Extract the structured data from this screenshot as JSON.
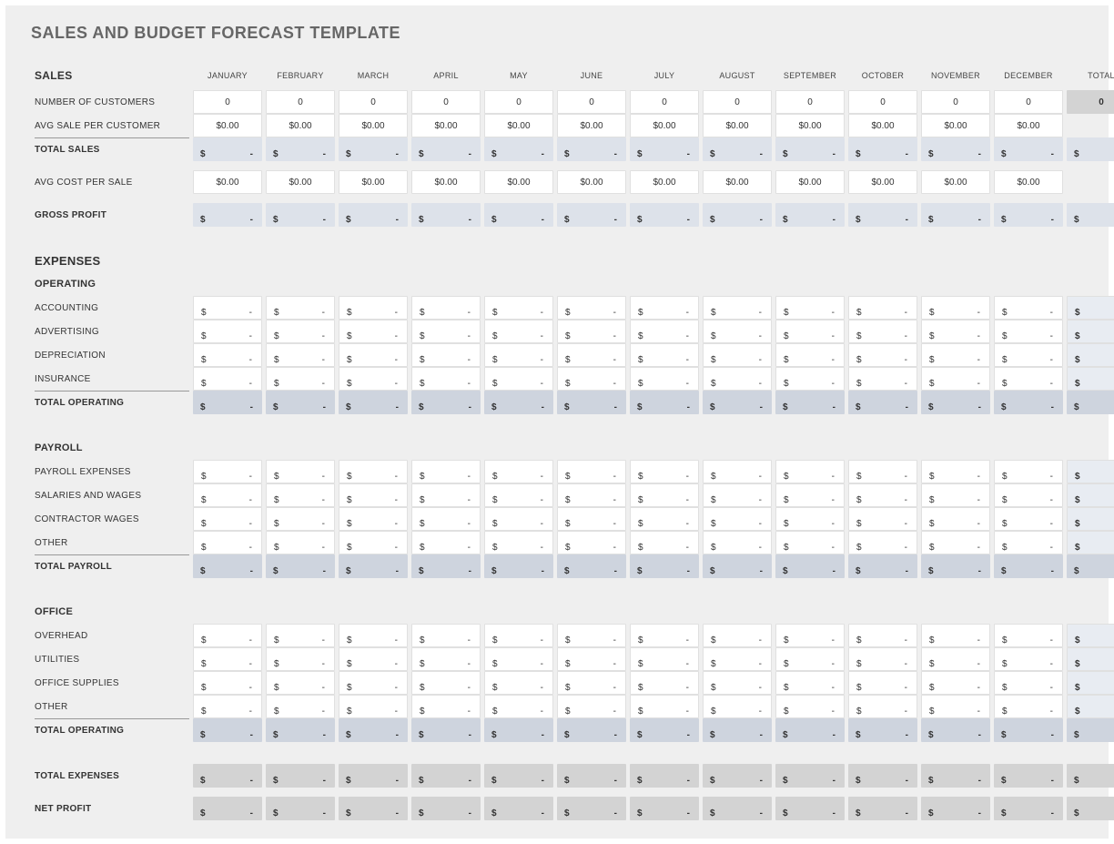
{
  "title": "SALES AND BUDGET FORECAST TEMPLATE",
  "months": [
    "JANUARY",
    "FEBRUARY",
    "MARCH",
    "APRIL",
    "MAY",
    "JUNE",
    "JULY",
    "AUGUST",
    "SEPTEMBER",
    "OCTOBER",
    "NOVEMBER",
    "DECEMBER"
  ],
  "total_label": "TOTAL",
  "sections": {
    "sales": {
      "label": "SALES",
      "rows": {
        "num_customers": {
          "label": "NUMBER OF CUSTOMERS",
          "type": "int",
          "values": [
            0,
            0,
            0,
            0,
            0,
            0,
            0,
            0,
            0,
            0,
            0,
            0
          ],
          "total": "0"
        },
        "avg_sale": {
          "label": "AVG SALE PER CUSTOMER",
          "type": "money0",
          "values": [
            "$0.00",
            "$0.00",
            "$0.00",
            "$0.00",
            "$0.00",
            "$0.00",
            "$0.00",
            "$0.00",
            "$0.00",
            "$0.00",
            "$0.00",
            "$0.00"
          ],
          "total": ""
        },
        "total_sales": {
          "label": "TOTAL SALES",
          "type": "calc",
          "values": [
            "-",
            "-",
            "-",
            "-",
            "-",
            "-",
            "-",
            "-",
            "-",
            "-",
            "-",
            "-"
          ],
          "total": "-"
        },
        "avg_cost": {
          "label": "AVG COST PER SALE",
          "type": "money0",
          "values": [
            "$0.00",
            "$0.00",
            "$0.00",
            "$0.00",
            "$0.00",
            "$0.00",
            "$0.00",
            "$0.00",
            "$0.00",
            "$0.00",
            "$0.00",
            "$0.00"
          ],
          "total": ""
        },
        "gross_profit": {
          "label": "GROSS PROFIT",
          "type": "calc",
          "values": [
            "-",
            "-",
            "-",
            "-",
            "-",
            "-",
            "-",
            "-",
            "-",
            "-",
            "-",
            "-"
          ],
          "total": "-"
        }
      }
    },
    "expenses": {
      "label": "EXPENSES",
      "operating": {
        "label": "OPERATING",
        "rows": [
          {
            "label": "ACCOUNTING",
            "values": [
              "-",
              "-",
              "-",
              "-",
              "-",
              "-",
              "-",
              "-",
              "-",
              "-",
              "-",
              "-"
            ],
            "total": "-"
          },
          {
            "label": "ADVERTISING",
            "values": [
              "-",
              "-",
              "-",
              "-",
              "-",
              "-",
              "-",
              "-",
              "-",
              "-",
              "-",
              "-"
            ],
            "total": "-"
          },
          {
            "label": "DEPRECIATION",
            "values": [
              "-",
              "-",
              "-",
              "-",
              "-",
              "-",
              "-",
              "-",
              "-",
              "-",
              "-",
              "-"
            ],
            "total": "-"
          },
          {
            "label": "INSURANCE",
            "values": [
              "-",
              "-",
              "-",
              "-",
              "-",
              "-",
              "-",
              "-",
              "-",
              "-",
              "-",
              "-"
            ],
            "total": "-"
          }
        ],
        "total": {
          "label": "TOTAL OPERATING",
          "values": [
            "-",
            "-",
            "-",
            "-",
            "-",
            "-",
            "-",
            "-",
            "-",
            "-",
            "-",
            "-"
          ],
          "total": "-"
        }
      },
      "payroll": {
        "label": "PAYROLL",
        "rows": [
          {
            "label": "PAYROLL EXPENSES",
            "values": [
              "-",
              "-",
              "-",
              "-",
              "-",
              "-",
              "-",
              "-",
              "-",
              "-",
              "-",
              "-"
            ],
            "total": "-"
          },
          {
            "label": "SALARIES AND WAGES",
            "values": [
              "-",
              "-",
              "-",
              "-",
              "-",
              "-",
              "-",
              "-",
              "-",
              "-",
              "-",
              "-"
            ],
            "total": "-"
          },
          {
            "label": "CONTRACTOR WAGES",
            "values": [
              "-",
              "-",
              "-",
              "-",
              "-",
              "-",
              "-",
              "-",
              "-",
              "-",
              "-",
              "-"
            ],
            "total": "-"
          },
          {
            "label": "OTHER",
            "values": [
              "-",
              "-",
              "-",
              "-",
              "-",
              "-",
              "-",
              "-",
              "-",
              "-",
              "-",
              "-"
            ],
            "total": "-"
          }
        ],
        "total": {
          "label": "TOTAL PAYROLL",
          "values": [
            "-",
            "-",
            "-",
            "-",
            "-",
            "-",
            "-",
            "-",
            "-",
            "-",
            "-",
            "-"
          ],
          "total": "-"
        }
      },
      "office": {
        "label": "OFFICE",
        "rows": [
          {
            "label": "OVERHEAD",
            "values": [
              "-",
              "-",
              "-",
              "-",
              "-",
              "-",
              "-",
              "-",
              "-",
              "-",
              "-",
              "-"
            ],
            "total": "-"
          },
          {
            "label": "UTILITIES",
            "values": [
              "-",
              "-",
              "-",
              "-",
              "-",
              "-",
              "-",
              "-",
              "-",
              "-",
              "-",
              "-"
            ],
            "total": "-"
          },
          {
            "label": "OFFICE SUPPLIES",
            "values": [
              "-",
              "-",
              "-",
              "-",
              "-",
              "-",
              "-",
              "-",
              "-",
              "-",
              "-",
              "-"
            ],
            "total": "-"
          },
          {
            "label": "OTHER",
            "values": [
              "-",
              "-",
              "-",
              "-",
              "-",
              "-",
              "-",
              "-",
              "-",
              "-",
              "-",
              "-"
            ],
            "total": "-"
          }
        ],
        "total": {
          "label": "TOTAL OPERATING",
          "values": [
            "-",
            "-",
            "-",
            "-",
            "-",
            "-",
            "-",
            "-",
            "-",
            "-",
            "-",
            "-"
          ],
          "total": "-"
        }
      },
      "total_expenses": {
        "label": "TOTAL EXPENSES",
        "values": [
          "-",
          "-",
          "-",
          "-",
          "-",
          "-",
          "-",
          "-",
          "-",
          "-",
          "-",
          "-"
        ],
        "total": "-"
      },
      "net_profit": {
        "label": "NET PROFIT",
        "values": [
          "-",
          "-",
          "-",
          "-",
          "-",
          "-",
          "-",
          "-",
          "-",
          "-",
          "-",
          "-"
        ],
        "total": "-"
      }
    }
  }
}
